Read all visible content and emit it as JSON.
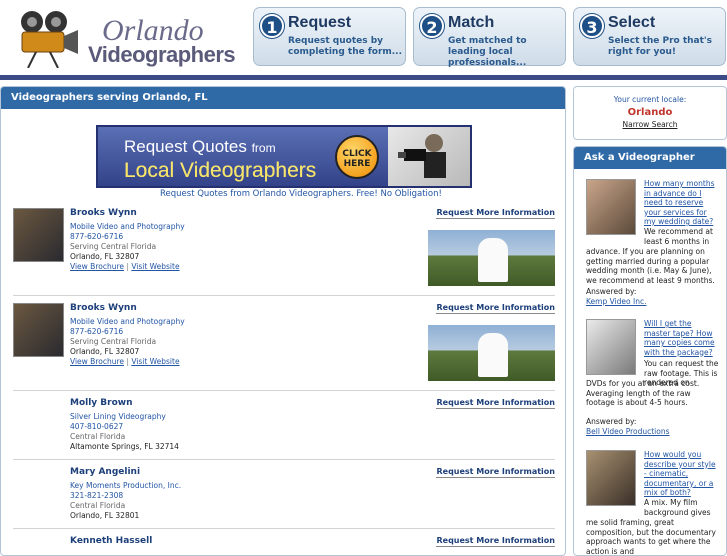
{
  "header": {
    "logo_line1": "Orlando",
    "logo_line2": "Videographers",
    "steps": [
      {
        "num": "1",
        "title": "Request",
        "desc": "Request quotes by completing the form..."
      },
      {
        "num": "2",
        "title": "Match",
        "desc": "Get matched to leading local professionals..."
      },
      {
        "num": "3",
        "title": "Select",
        "desc": "Select the Pro that's right for you!"
      }
    ]
  },
  "main": {
    "heading": "Videographers serving Orlando, FL",
    "banner": {
      "line1": "Request Quotes",
      "line1_small": "from",
      "line2": "Local Videographers",
      "cta": "CLICK HERE"
    },
    "tagline": "Request Quotes from Orlando Videographers. Free! No Obligation!",
    "request_label": "Request More Information",
    "listings": [
      {
        "name": "Brooks Wynn",
        "company": "Mobile Video and Photography",
        "phone": "877-620-6716",
        "area": "Serving Central Florida",
        "city": "Orlando, FL 32807",
        "brochure": "View Brochure",
        "sep": "|",
        "website": "Visit Website"
      },
      {
        "name": "Brooks Wynn",
        "company": "Mobile Video and Photography",
        "phone": "877-620-6716",
        "area": "Serving Central Florida",
        "city": "Orlando, FL 32807",
        "brochure": "View Brochure",
        "sep": "|",
        "website": "Visit Website"
      },
      {
        "name": "Molly Brown",
        "company": "Silver Lining Videography",
        "phone": "407-810-0627",
        "area": "Central Florida",
        "city": "Altamonte Springs, FL 32714"
      },
      {
        "name": "Mary Angelini",
        "company": "Key Moments Production, Inc.",
        "phone": "321-821-2308",
        "area": "Central Florida",
        "city": "Orlando, FL 32801"
      },
      {
        "name": "Kenneth Hassell"
      }
    ]
  },
  "locale": {
    "label": "Your current locale:",
    "city": "Orlando",
    "narrow": "Narrow Search"
  },
  "ask": {
    "heading": "Ask a Videographer",
    "items": [
      {
        "question": "How many months in advance do I need to reserve your services for my wedding date?",
        "answer_short": "We recommend at least 6 months in",
        "answer_rest": "advance. If you are planning on getting married during a popular wedding month (i.e. May & June), we recommend at least 9 months.",
        "by_label": "Answered by:",
        "by": "Kemp Video Inc."
      },
      {
        "question": "Will I get the master tape? How many copies come with the package?",
        "answer_short": "You can request the raw footage. This is rendered on",
        "answer_rest": "DVDs for you at an extra cost. Averaging length of the raw footage is about 4-5 hours.",
        "by_label": "Answered by:",
        "by": "Bell Video Productions"
      },
      {
        "question": "How would you describe your style - cinematic, documentary, or a mix of both?",
        "answer_short": "A mix. My film background gives",
        "answer_rest": "me solid framing, great composition, but the documentary approach wants to get where the action is and"
      }
    ]
  }
}
